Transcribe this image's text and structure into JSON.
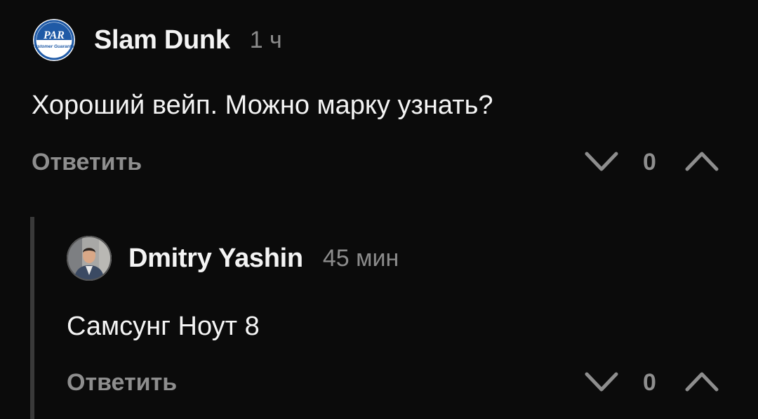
{
  "comments": [
    {
      "author": "Slam Dunk",
      "time": "1 ч",
      "text": "Хороший вейп. Можно марку узнать?",
      "reply_label": "Ответить",
      "vote_count": "0",
      "avatar_logo_text": "PAR",
      "avatar_logo_subtext": "Customer Guarantee"
    },
    {
      "author": "Dmitry Yashin",
      "time": "45 мин",
      "text": "Самсунг Ноут 8",
      "reply_label": "Ответить",
      "vote_count": "0"
    }
  ],
  "colors": {
    "background": "#0b0b0b",
    "text": "#f4f4f4",
    "muted": "#8e8e8e",
    "thread_line": "#3a3a3a",
    "logo_blue": "#1f5aa6"
  },
  "icons": {
    "downvote": "chevron-down-icon",
    "upvote": "chevron-up-icon"
  }
}
